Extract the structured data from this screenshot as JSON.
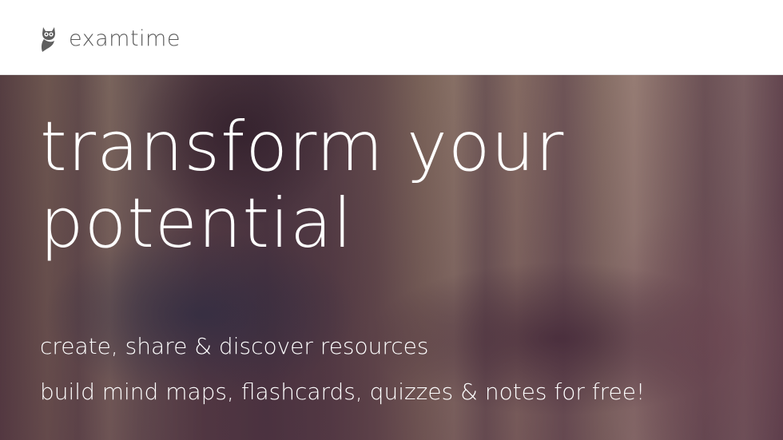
{
  "header": {
    "logo_text": "examtime",
    "logo_icon": "owl-icon"
  },
  "hero": {
    "headline_line1": "transform your",
    "headline_line2": "potential",
    "tagline_1": "create, share & discover resources",
    "tagline_2": "build mind maps, flashcards, quizzes & notes for free!"
  },
  "colors": {
    "header_bg": "#ffffff",
    "logo_text": "#5a5a5a",
    "hero_text": "#ffffff"
  }
}
